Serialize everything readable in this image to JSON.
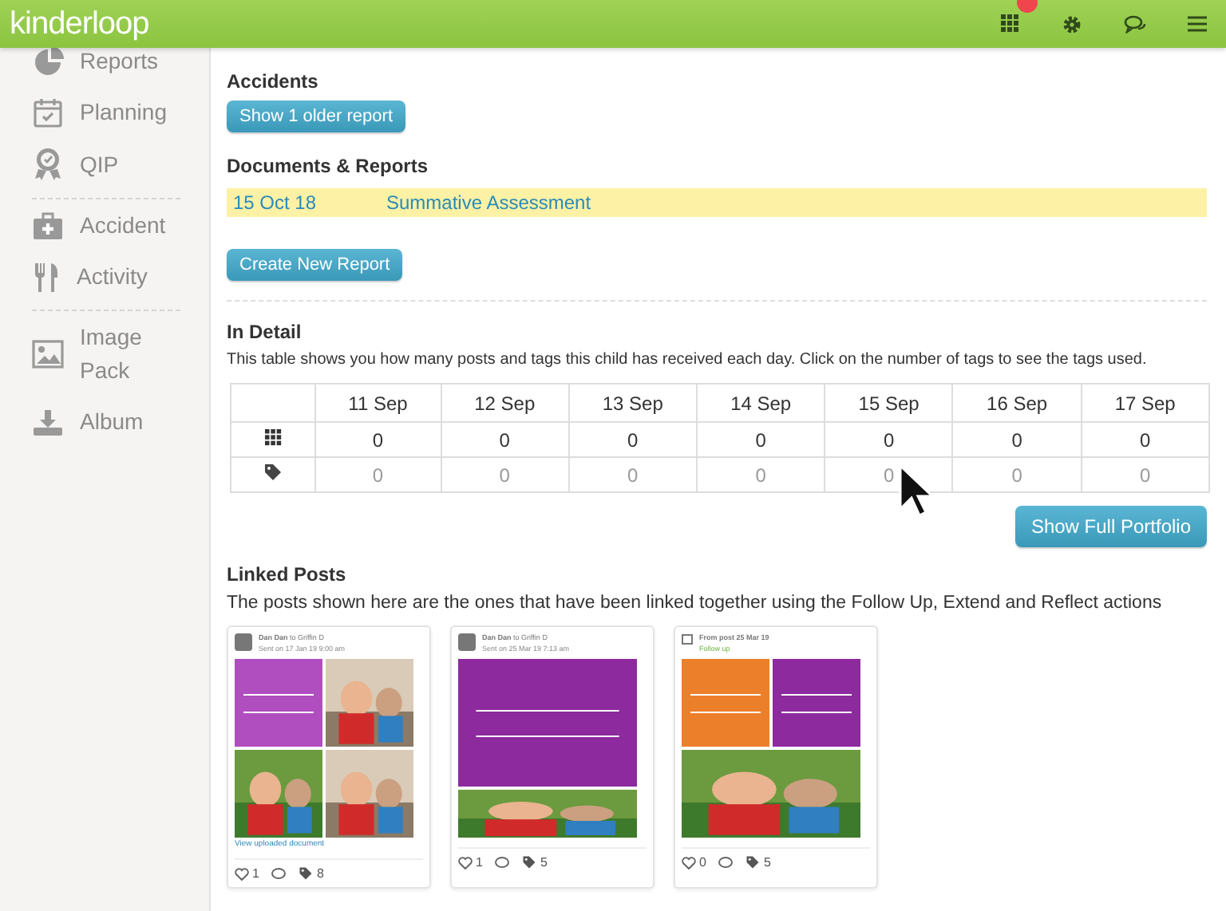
{
  "header": {
    "logo": "kinderloop",
    "alert": true
  },
  "sidebar": {
    "groups": [
      [
        {
          "label": "Reports"
        },
        {
          "label": "Planning"
        },
        {
          "label": "QIP"
        }
      ],
      [
        {
          "label": "Accident"
        },
        {
          "label": "Activity"
        }
      ],
      [
        {
          "label": "Image Pack"
        },
        {
          "label": "Album"
        }
      ]
    ]
  },
  "accidents": {
    "title": "Accidents",
    "button": "Show 1 older report"
  },
  "documents": {
    "title": "Documents & Reports",
    "rows": [
      {
        "date": "15 Oct 18",
        "name": "Summative Assessment",
        "highlighted": true
      }
    ],
    "button": "Create New Report"
  },
  "in_detail": {
    "title": "In Detail",
    "description": "This table shows you how many posts and tags this child has received each day. Click on the number of tags to see the tags used.",
    "columns": [
      "11 Sep",
      "12 Sep",
      "13 Sep",
      "14 Sep",
      "15 Sep",
      "16 Sep",
      "17 Sep"
    ],
    "rows": [
      {
        "kind": "posts",
        "values": [
          "0",
          "0",
          "0",
          "0",
          "0",
          "0",
          "0"
        ]
      },
      {
        "kind": "tags",
        "values": [
          "0",
          "0",
          "0",
          "0",
          "0",
          "0",
          "0"
        ]
      }
    ],
    "button": "Show Full Portfolio"
  },
  "linked_posts": {
    "title": "Linked Posts",
    "description": "The posts shown here are the ones that have been linked together using the Follow Up, Extend and Reflect actions",
    "posts": [
      {
        "kind": "grid",
        "author": "**Dan Dan** to Griffin D",
        "meta": "Sent on 17 Jan 19 9:00 am",
        "link": "View uploaded document",
        "likes": "1",
        "tags": "8"
      },
      {
        "kind": "banner",
        "author": "**Dan Dan** to Griffin D",
        "meta": "Sent on 25 Mar 19 7:13 am",
        "likes": "1",
        "tags": "5"
      },
      {
        "kind": "split",
        "author": "**From post 25 Mar 19**",
        "meta": "Follow up",
        "likes": "0",
        "tags": "5"
      }
    ]
  }
}
